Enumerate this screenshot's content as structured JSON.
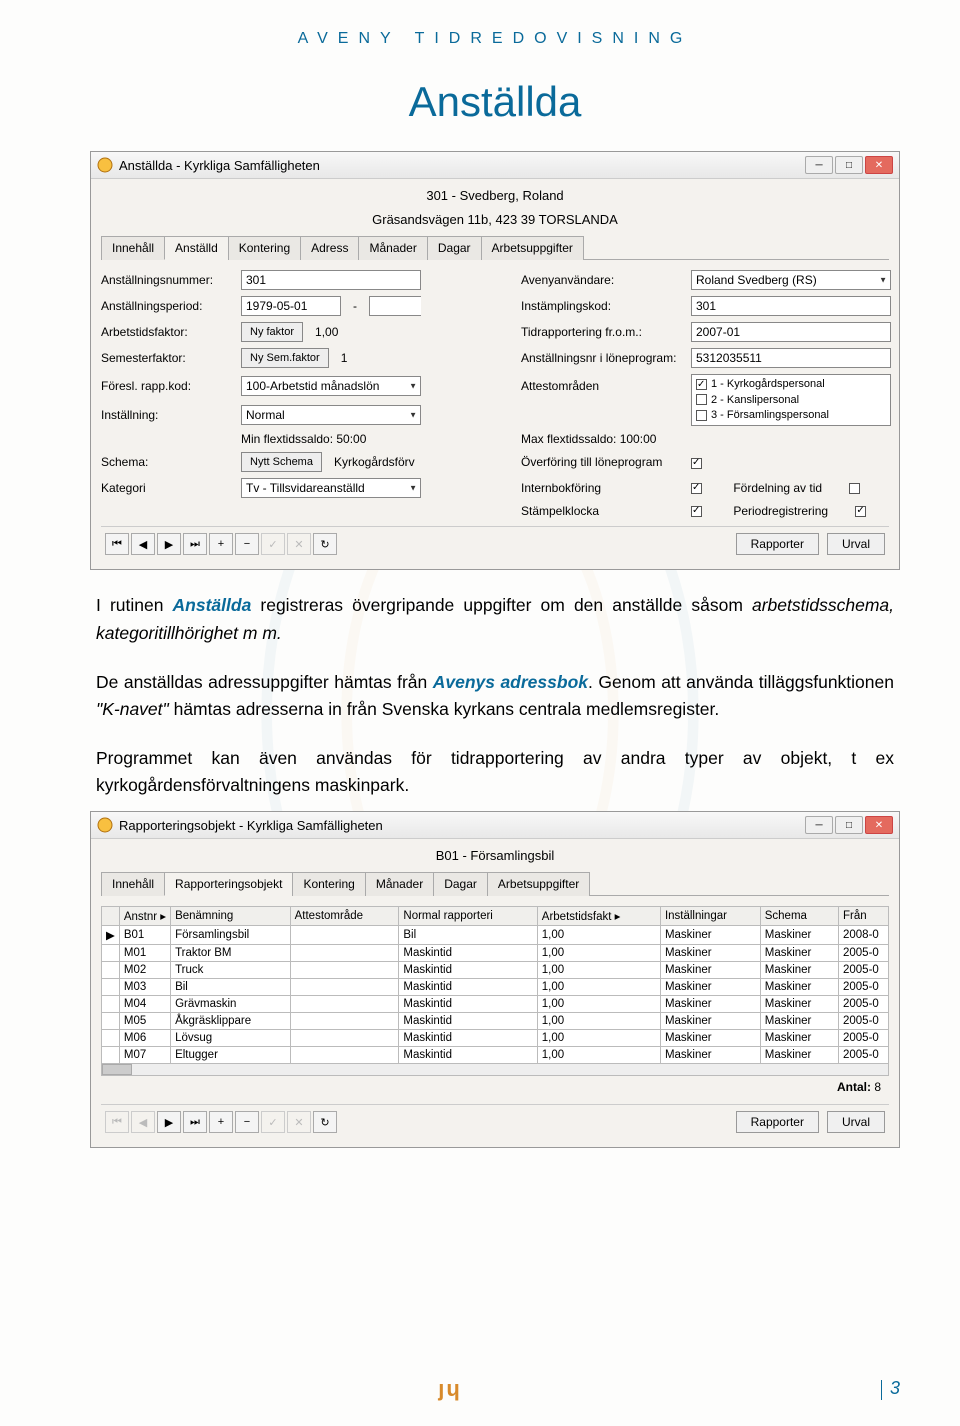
{
  "header": "AVENY TIDREDOVISNING",
  "doc_title": "Anställda",
  "window1": {
    "title": "Anställda - Kyrkliga Samfälligheten",
    "info1": "301 - Svedberg, Roland",
    "info2": "Gräsandsvägen 11b, 423 39  TORSLANDA",
    "tabs": [
      "Innehåll",
      "Anställd",
      "Kontering",
      "Adress",
      "Månader",
      "Dagar",
      "Arbetsuppgifter"
    ],
    "active_tab": 1,
    "labels": {
      "anst_nr": "Anställningsnummer:",
      "aveny_anv": "Avenyanvändare:",
      "anst_period": "Anställningsperiod:",
      "instampl": "Instämplingskod:",
      "arbfaktor": "Arbetstidsfaktor:",
      "tidrapp": "Tidrapportering fr.o.m.:",
      "semfaktor": "Semesterfaktor:",
      "anst_lone": "Anställningsnr i löneprogram:",
      "foresl": "Föresl. rapp.kod:",
      "attest": "Attestområden",
      "install": "Inställning:",
      "schema": "Schema:",
      "kategori": "Kategori",
      "ny_faktor": "Ny faktor",
      "ny_sem": "Ny Sem.faktor",
      "min_flex": "Min flextidssaldo: 50:00",
      "max_flex": "Max flextidssaldo:   100:00",
      "overforing": "Överföring till löneprogram",
      "internbok": "Internbokföring",
      "stampel": "Stämpelklocka",
      "fordelning": "Fördelning av tid",
      "periodreg": "Periodregistrering",
      "nytt_schema": "Nytt Schema"
    },
    "values": {
      "anst_nr": "301",
      "aveny_anv": "Roland Svedberg (RS)",
      "period": "1979-05-01",
      "instampl": "301",
      "arbfaktor": "1,00",
      "tidrapp": "2007-01",
      "semfaktor": "1",
      "anst_lone": "5312035511",
      "foresl": "100-Arbetstid månadslön",
      "install": "Normal",
      "schema_val": "Kyrkogårdsförv",
      "kategori": "Tv - Tillsvidareanställd",
      "attest_items": [
        "1 - Kyrkogårdspersonal",
        "2 - Kanslipersonal",
        "3 - Församlingspersonal"
      ]
    },
    "buttons": {
      "rapporter": "Rapporter",
      "urval": "Urval"
    }
  },
  "paragraphs": {
    "p1_a": "I rutinen ",
    "p1_an": "Anställda",
    "p1_b": " registreras övergripande uppgifter om den anställde såsom ",
    "p1_c": "arbetstidsschema, kategoritillhörighet m m.",
    "p2_a": "De anställdas adressuppgifter hämtas från ",
    "p2_ab": "Avenys adressbok",
    "p2_b": ". Genom att använda tilläggsfunktionen ",
    "p2_kn": "\"K-navet\"",
    "p2_c": " hämtas adresserna in från Svenska kyrkans centrala medlemsregister.",
    "p3": "Programmet kan även användas för tidrapportering av andra typer av objekt, t ex kyrkogårdensförvaltningens maskinpark."
  },
  "window2": {
    "title": "Rapporteringsobjekt - Kyrkliga Samfälligheten",
    "subtitle": "B01 - Församlingsbil",
    "tabs": [
      "Innehåll",
      "Rapporteringsobjekt",
      "Kontering",
      "Månader",
      "Dagar",
      "Arbetsuppgifter"
    ],
    "active_tab": 1,
    "cols": [
      "Anstnr",
      "Benämning",
      "Attestområde",
      "Normal rapporteri",
      "Arbetstidsfakt",
      "Inställningar",
      "Schema",
      "Från"
    ],
    "rows": [
      [
        "B01",
        "Församlingsbil",
        "",
        "Bil",
        "1,00",
        "Maskiner",
        "Maskiner",
        "2008-0"
      ],
      [
        "M01",
        "Traktor BM",
        "",
        "Maskintid",
        "1,00",
        "Maskiner",
        "Maskiner",
        "2005-0"
      ],
      [
        "M02",
        "Truck",
        "",
        "Maskintid",
        "1,00",
        "Maskiner",
        "Maskiner",
        "2005-0"
      ],
      [
        "M03",
        "Bil",
        "",
        "Maskintid",
        "1,00",
        "Maskiner",
        "Maskiner",
        "2005-0"
      ],
      [
        "M04",
        "Grävmaskin",
        "",
        "Maskintid",
        "1,00",
        "Maskiner",
        "Maskiner",
        "2005-0"
      ],
      [
        "M05",
        "Åkgräsklippare",
        "",
        "Maskintid",
        "1,00",
        "Maskiner",
        "Maskiner",
        "2005-0"
      ],
      [
        "M06",
        "Lövsug",
        "",
        "Maskintid",
        "1,00",
        "Maskiner",
        "Maskiner",
        "2005-0"
      ],
      [
        "M07",
        "Eltugger",
        "",
        "Maskintid",
        "1,00",
        "Maskiner",
        "Maskiner",
        "2005-0"
      ]
    ],
    "antal_label": "Antal:",
    "antal": "8",
    "buttons": {
      "rapporter": "Rapporter",
      "urval": "Urval"
    }
  },
  "page_number": "3"
}
